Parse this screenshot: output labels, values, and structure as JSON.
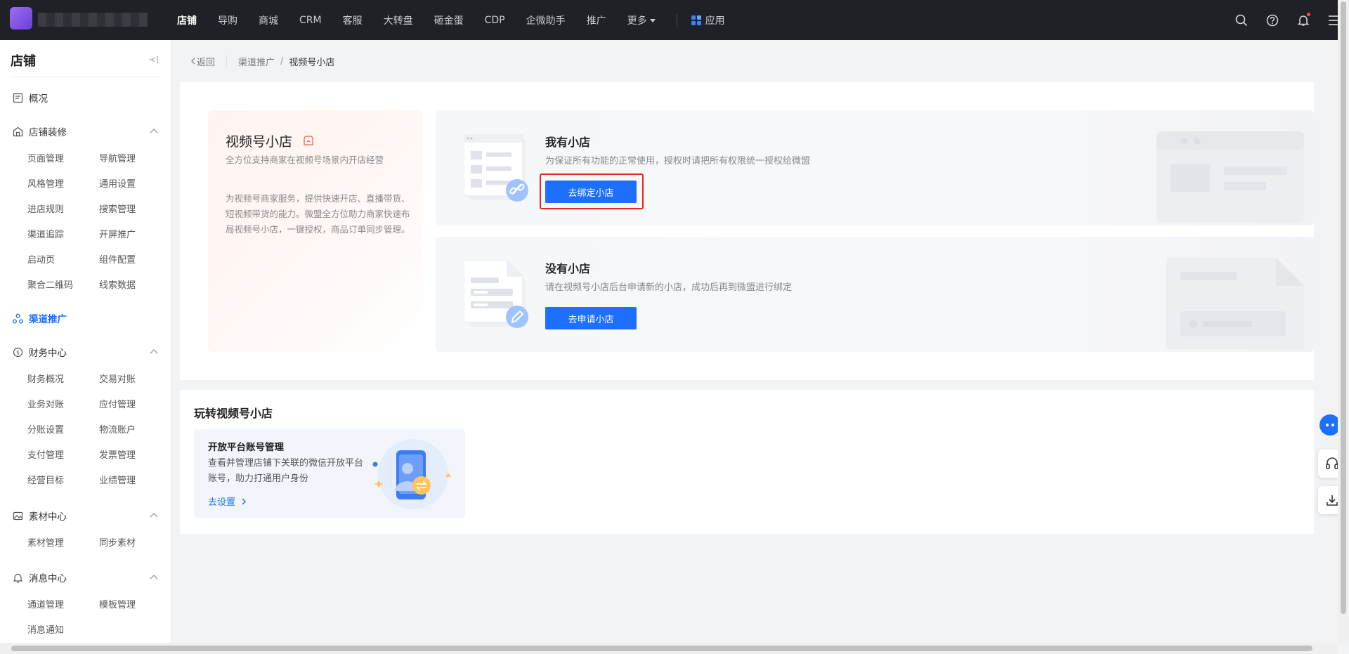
{
  "topbar": {
    "nav": [
      "店铺",
      "导购",
      "商城",
      "CRM",
      "客服",
      "大转盘",
      "砸金蛋",
      "CDP",
      "企微助手",
      "推广",
      "更多"
    ],
    "active_index": 0,
    "apps_label": "应用"
  },
  "sidebar": {
    "title": "店铺",
    "overview": "概况",
    "groups": {
      "decor": {
        "label": "店铺装修",
        "items": [
          "页面管理",
          "导航管理",
          "风格管理",
          "通用设置",
          "进店规则",
          "搜索管理",
          "渠道追踪",
          "开屏推广",
          "启动页",
          "组件配置",
          "聚合二维码",
          "线索数据"
        ]
      },
      "channel": {
        "label": "渠道推广"
      },
      "finance": {
        "label": "财务中心",
        "items": [
          "财务概况",
          "交易对账",
          "业务对账",
          "应付管理",
          "分账设置",
          "物流账户",
          "支付管理",
          "发票管理",
          "经营目标",
          "业绩管理"
        ]
      },
      "material": {
        "label": "素材中心",
        "items": [
          "素材管理",
          "同步素材"
        ]
      },
      "message": {
        "label": "消息中心",
        "items": [
          "通道管理",
          "模板管理",
          "消息通知"
        ]
      }
    }
  },
  "breadcrumb": {
    "back": "返回",
    "parent": "渠道推广",
    "current": "视频号小店"
  },
  "intro": {
    "title": "视频号小店",
    "subtitle": "全方位支持商家在视频号场景内开店经营",
    "desc": "为视频号商家服务，提供快速开店、直播带货、短视频带货的能力。微盟全方位助力商家快速布局视频号小店，一键授权，商品订单同步管理。"
  },
  "options": {
    "have": {
      "title": "我有小店",
      "desc": "为保证所有功能的正常使用，授权时请把所有权限统一授权给微盟",
      "button": "去绑定小店"
    },
    "none": {
      "title": "没有小店",
      "desc": "请在视频号小店后台申请新的小店，成功后再到微盟进行绑定",
      "button": "去申请小店"
    }
  },
  "guide": {
    "title": "玩转视频号小店",
    "card": {
      "title": "开放平台账号管理",
      "desc": "查看并管理店铺下关联的微信开放平台账号，助力打通用户身份",
      "link": "去设置"
    }
  },
  "colors": {
    "primary": "#1d6fff",
    "topbar_bg": "#1f2126",
    "highlight": "#e62222"
  }
}
